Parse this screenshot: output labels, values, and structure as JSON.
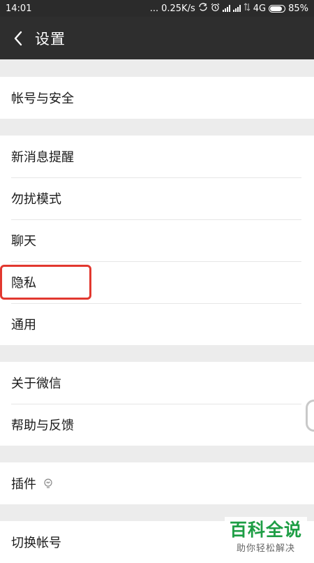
{
  "status_bar": {
    "time": "14:01",
    "dots": "...",
    "speed": "0.25K/s",
    "network": "4G",
    "battery": "85%"
  },
  "nav": {
    "title": "设置"
  },
  "groups": {
    "account": {
      "items": [
        "帐号与安全"
      ]
    },
    "main": {
      "items": [
        "新消息提醒",
        "勿扰模式",
        "聊天",
        "隐私",
        "通用"
      ]
    },
    "about": {
      "items": [
        "关于微信",
        "帮助与反馈"
      ]
    },
    "plugins": {
      "items": [
        "插件"
      ]
    },
    "switch": {
      "items": [
        "切换帐号"
      ]
    }
  },
  "watermark": {
    "title": "百科全说",
    "subtitle": "助你轻松解决"
  },
  "colors": {
    "header_bg": "#2e2e2e",
    "page_bg": "#ececec",
    "highlight": "#e2382f",
    "watermark_green": "#1e9e45"
  },
  "icons": {
    "back": "chevron-left-icon",
    "plugin": "plugin-bulb-icon"
  }
}
